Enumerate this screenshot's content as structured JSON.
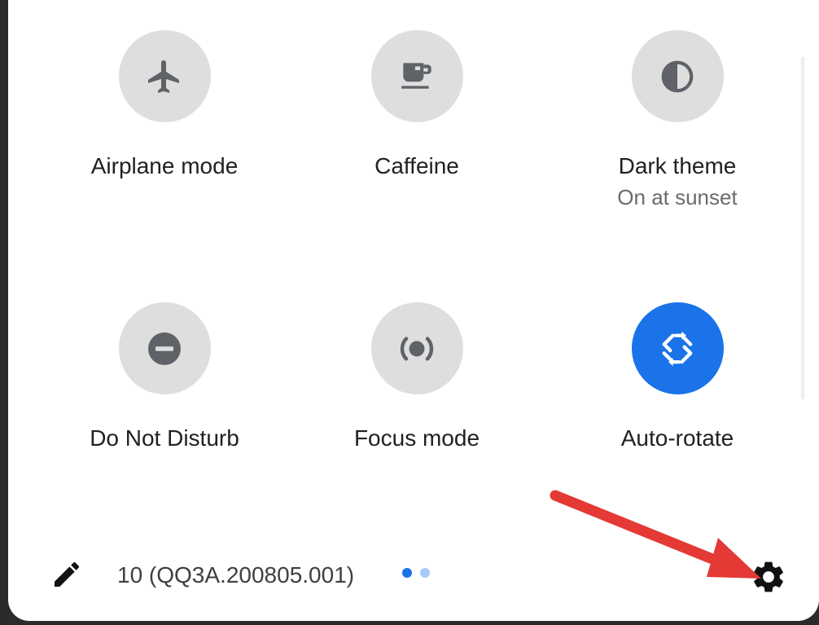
{
  "tiles": [
    {
      "label": "Airplane mode",
      "subtitle": "",
      "icon": "airplane-icon",
      "active": false
    },
    {
      "label": "Caffeine",
      "subtitle": "",
      "icon": "coffee-cup-icon",
      "active": false
    },
    {
      "label": "Dark theme",
      "subtitle": "On at sunset",
      "icon": "dark-theme-icon",
      "active": false
    },
    {
      "label": "Do Not Disturb",
      "subtitle": "",
      "icon": "do-not-disturb-icon",
      "active": false
    },
    {
      "label": "Focus mode",
      "subtitle": "",
      "icon": "focus-mode-icon",
      "active": false
    },
    {
      "label": "Auto-rotate",
      "subtitle": "",
      "icon": "auto-rotate-icon",
      "active": true
    }
  ],
  "footer": {
    "edit_icon": "pencil-icon",
    "build_number": "10 (QQ3A.200805.001)",
    "settings_icon": "gear-icon",
    "page_count": 2,
    "current_page": 1
  },
  "colors": {
    "tile_inactive": "#dedede",
    "tile_active": "#1a73e8",
    "icon_inactive": "#5f6368",
    "icon_active": "#ffffff",
    "dot_active": "#1a73e8",
    "dot_inactive": "#a8c7fa",
    "annotation_arrow": "#e53935"
  }
}
